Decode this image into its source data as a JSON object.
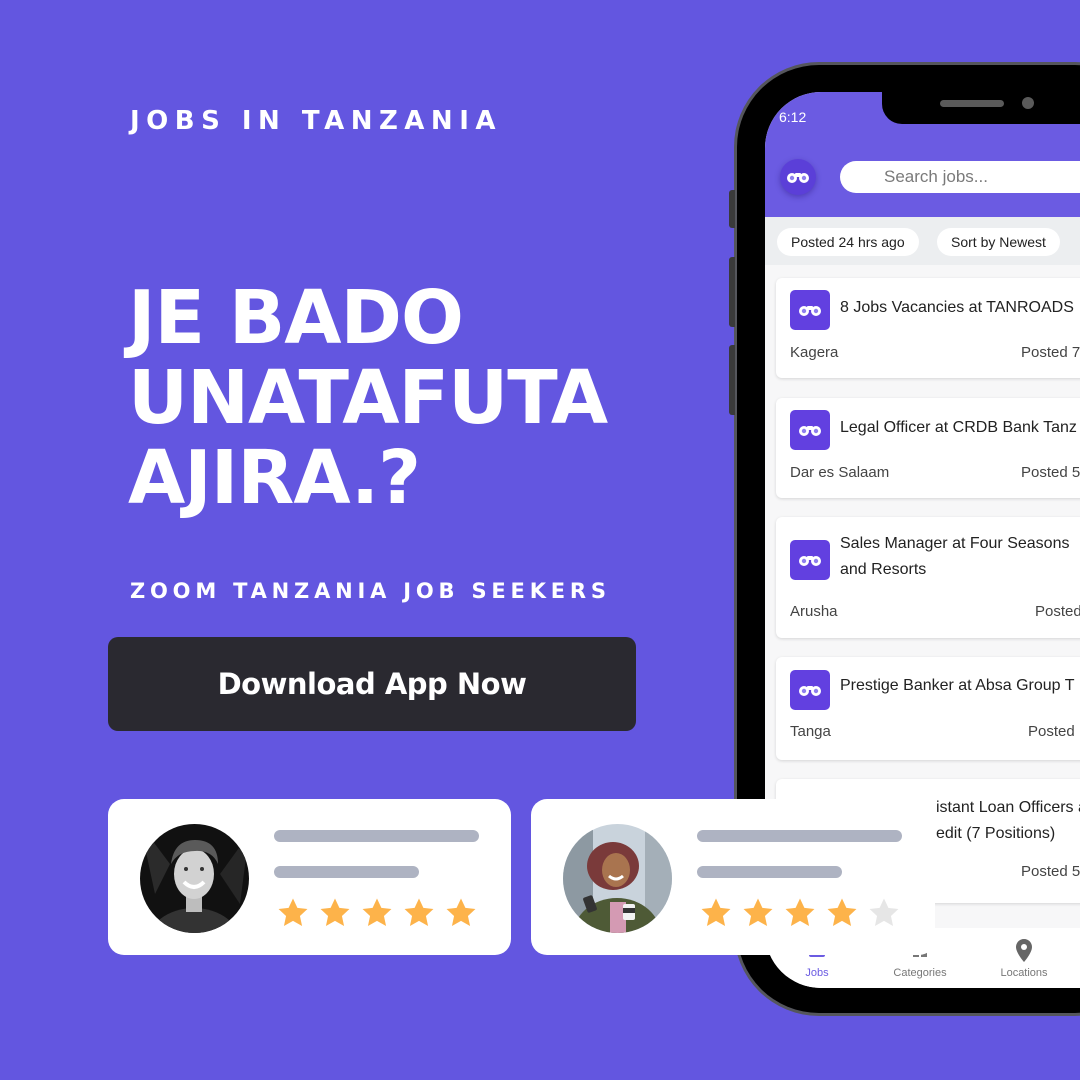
{
  "promo": {
    "eyebrow": "JOBS IN TANZANIA",
    "headline_lines": [
      "JE BADO",
      "UNATAFUTA",
      "AJIRA.?"
    ],
    "subhead": "ZOOM TANZANIA JOB SEEKERS",
    "cta_label": "Download App Now"
  },
  "colors": {
    "background": "#6356E0",
    "app_header": "#6B5BE2",
    "cta_bg": "#2A2930",
    "star_filled": "#FDB34A",
    "star_empty": "#E6E6E6",
    "placeholder_bar": "#AEB3C2"
  },
  "phone": {
    "status_time": "6:12",
    "app_logo_icon": "binoculars-icon",
    "search_placeholder": "Search jobs...",
    "filters": [
      "Posted 24 hrs ago",
      "Sort by Newest"
    ],
    "jobs": [
      {
        "title": "8 Jobs Vacancies at TANROADS",
        "location": "Kagera",
        "posted": "Posted 7"
      },
      {
        "title": "Legal Officer at CRDB Bank Tanz",
        "location": "Dar es Salaam",
        "posted": "Posted 5"
      },
      {
        "title": "Sales Manager at Four Seasons",
        "title_line2": "and Resorts",
        "location": "Arusha",
        "posted": "Posted"
      },
      {
        "title": "Prestige Banker at Absa Group T",
        "location": "Tanga",
        "posted": "Posted"
      },
      {
        "title": "istant Loan Officers a",
        "title_line2": "edit (7 Positions)",
        "location": "",
        "posted": "Posted 5"
      }
    ],
    "nav": [
      {
        "label": "Jobs",
        "icon": "briefcase-icon",
        "active": true
      },
      {
        "label": "Categories",
        "icon": "grid-icon",
        "active": false
      },
      {
        "label": "Locations",
        "icon": "location-pin-icon",
        "active": false
      }
    ]
  },
  "reviews": [
    {
      "avatar": "young-man-smiling-bw-photo",
      "rating": 5,
      "max_rating": 5
    },
    {
      "avatar": "woman-with-phone-and-coffee-photo",
      "rating": 4,
      "max_rating": 5
    }
  ]
}
